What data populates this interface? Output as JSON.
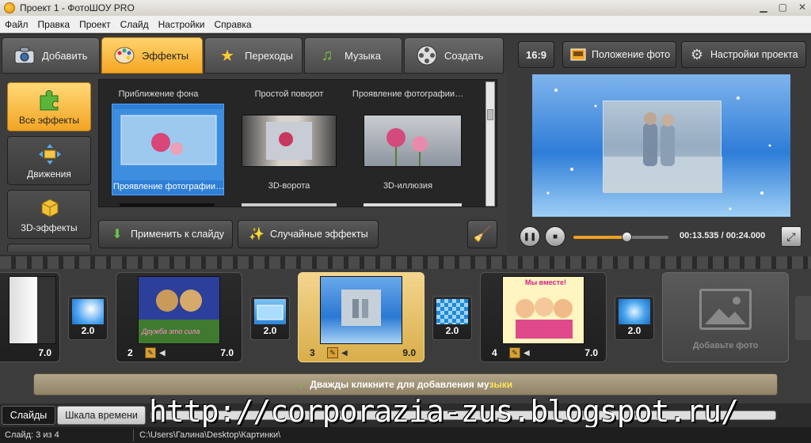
{
  "window": {
    "title": "Проект 1 - ФотоШОУ PRO"
  },
  "menu": [
    "Файл",
    "Правка",
    "Проект",
    "Слайд",
    "Настройки",
    "Справка"
  ],
  "tabs": [
    {
      "label": "Добавить",
      "icon": "camera-icon"
    },
    {
      "label": "Эффекты",
      "icon": "palette-icon",
      "active": true
    },
    {
      "label": "Переходы",
      "icon": "star-icon"
    },
    {
      "label": "Музыка",
      "icon": "music-note-icon"
    },
    {
      "label": "Создать",
      "icon": "film-reel-icon"
    }
  ],
  "categories": [
    {
      "label": "Все эффекты",
      "icon": "puzzle-icon",
      "active": true
    },
    {
      "label": "Движения",
      "icon": "move-arrows-icon"
    },
    {
      "label": "3D-эффекты",
      "icon": "cube-icon"
    }
  ],
  "effects": [
    {
      "title": "Приближение фона",
      "label": "Проявление фотографии…",
      "selected": true
    },
    {
      "title": "Простой поворот",
      "label": "3D-ворота"
    },
    {
      "title": "Проявление фотографии…",
      "label": "3D-иллюзия"
    }
  ],
  "buttons": {
    "apply": "Применить к слайду",
    "random": "Случайные эффекты"
  },
  "preview_toolbar": {
    "aspect": "16:9",
    "photo_position": "Положение фото",
    "project_settings": "Настройки проекта"
  },
  "player": {
    "current": "00:13.535",
    "total": "00:24.000",
    "time_display": "00:13.535 / 00:24.000",
    "progress": 0.56
  },
  "timeline": {
    "partial_slide_duration": "7.0",
    "slides": [
      {
        "number": "2",
        "duration": "7.0"
      },
      {
        "number": "3",
        "duration": "9.0",
        "active": true
      },
      {
        "number": "4",
        "duration": "7.0"
      }
    ],
    "transitions": [
      "2.0",
      "2.0",
      "2.0",
      "2.0"
    ],
    "add_photo": "Добавьте фото",
    "slide2_caption": "Дружба это сила",
    "slide4_caption": "Мы вместе!",
    "music_hint_main": "Дважды кликните для добавления му",
    "music_hint_tail": "зыки"
  },
  "bottom_tabs": {
    "slides": "Слайды",
    "timeline": "Шкала времени"
  },
  "watermark": "http://corporazia-zus.blogspot.ru/",
  "status": {
    "slide": "Слайд: 3 из 4",
    "path": "C:\\Users\\Галина\\Desktop\\Картинки\\"
  },
  "colors": {
    "accent": "#f5a623",
    "active_slide": "#e6c06a",
    "progress": "#f0a020",
    "music_track": "#a09477"
  }
}
